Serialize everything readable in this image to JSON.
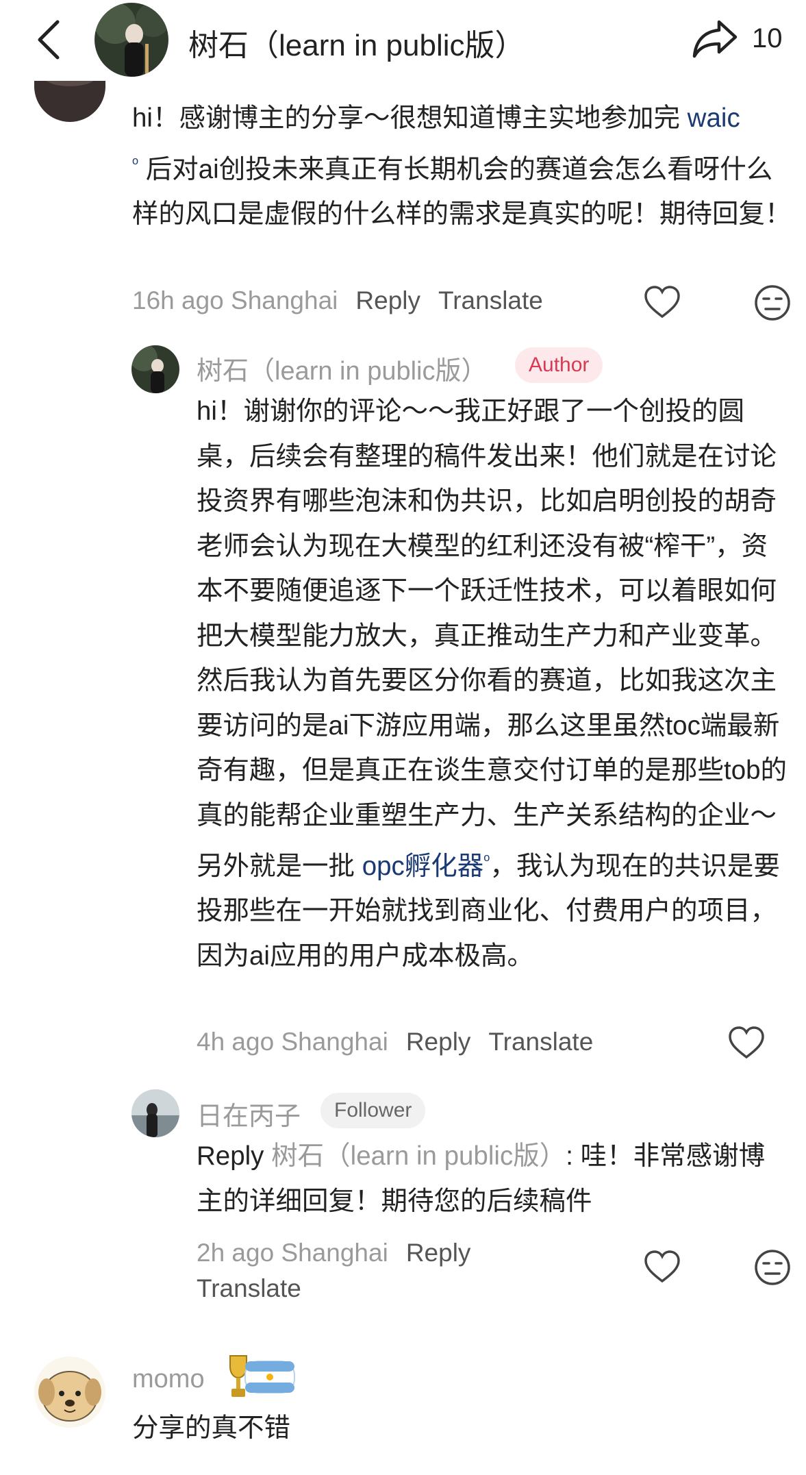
{
  "header": {
    "title": "树石（learn in public版）",
    "share_count": "10"
  },
  "comment": {
    "text_before_link": "hi！感谢博主的分享～很想知道博主实地参加完 ",
    "link": "waic",
    "text_after_link": " 后对ai创投未来真正有长期机会的赛道会怎么看呀什么样的风口是虚假的什么样的需求是真实的呢！期待回复！",
    "time": "16h ago Shanghai",
    "reply_label": "Reply",
    "translate_label": "Translate"
  },
  "author_reply": {
    "name": "树石（learn in public版）",
    "badge": "Author",
    "text_before_link": "hi！谢谢你的评论～～我正好跟了一个创投的圆桌，后续会有整理的稿件发出来！他们就是在讨论投资界有哪些泡沫和伪共识，比如启明创投的胡奇老师会认为现在大模型的红利还没有被“榨干”，资本不要随便追逐下一个跃迁性技术，可以着眼如何把大模型能力放大，真正推动生产力和产业变革。然后我认为首先要区分你看的赛道，比如我这次主要访问的是ai下游应用端，那么这里虽然toc端最新奇有趣，但是真正在谈生意交付订单的是那些tob的真的能帮企业重塑生产力、生产关系结构的企业～另外就是一批 ",
    "link": "opc孵化器",
    "text_after_link": "，我认为现在的共识是要投那些在一开始就找到商业化、付费用户的项目，因为ai应用的用户成本极高。",
    "time": "4h ago Shanghai",
    "reply_label": "Reply",
    "translate_label": "Translate"
  },
  "follower_reply": {
    "name": "日在丙子",
    "badge": "Follower",
    "reply_prefix": "Reply",
    "reply_target": "树石（learn in public版）",
    "text": ": 哇！非常感谢博主的详细回复！期待您的后续稿件",
    "time": "2h ago Shanghai",
    "reply_label": "Reply",
    "translate_label": "Translate"
  },
  "next_comment": {
    "name": "momo",
    "text": "分享的真不错"
  },
  "icons": {
    "back": "chevron-left-icon",
    "share": "share-arrow-icon",
    "like": "heart-outline-icon",
    "dislike": "unamused-face-icon",
    "search": "search-icon",
    "trophy": "trophy-icon",
    "flag": "argentina-flag-icon"
  },
  "colors": {
    "link": "#1b3a73",
    "author_badge_bg": "#fde9ec",
    "author_badge_text": "#d83a52",
    "follower_badge_bg": "#f1f1f1",
    "meta_gray": "#9a9a9a"
  }
}
